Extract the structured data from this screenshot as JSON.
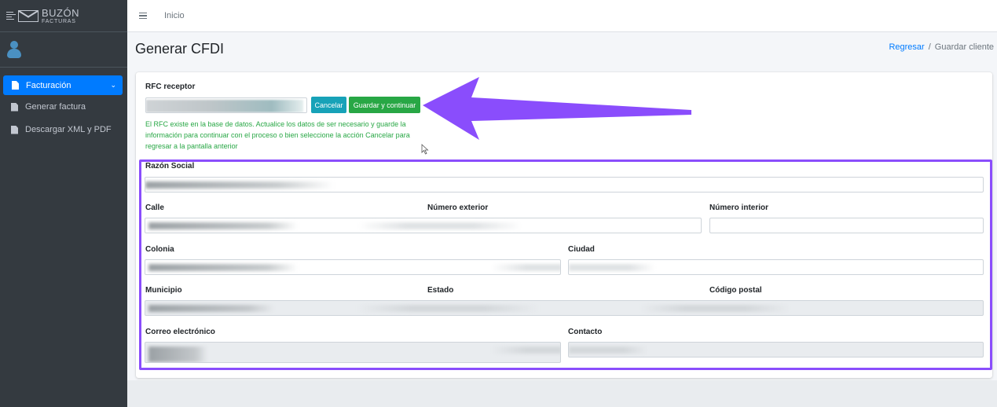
{
  "brand": {
    "name_top": "BUZÓN",
    "name_bottom": "FACTURAS"
  },
  "sidebar": {
    "items": [
      {
        "label": "Facturación",
        "active": true
      },
      {
        "label": "Generar factura",
        "active": false
      },
      {
        "label": "Descargar XML y PDF",
        "active": false
      }
    ]
  },
  "header": {
    "home_label": "Inicio"
  },
  "page": {
    "title": "Generar CFDI",
    "breadcrumb": {
      "back_link": "Regresar",
      "separator": "/",
      "current": "Guardar cliente"
    }
  },
  "form": {
    "rfc_label": "RFC receptor",
    "cancel_label": "Cancelar",
    "save_label": "Guardar y continuar",
    "help_text": "El RFC existe en la base de datos. Actualice los datos de ser necesario y guarde la información para continuar con el proceso o bien seleccione la acción Cancelar para regresar a la pantalla anterior",
    "fields": {
      "razon_social": "Razón Social",
      "calle": "Calle",
      "numero_exterior": "Número exterior",
      "numero_interior": "Número interior",
      "colonia": "Colonia",
      "ciudad": "Ciudad",
      "municipio": "Municipio",
      "estado": "Estado",
      "codigo_postal": "Código postal",
      "correo": "Correo electrónico",
      "contacto": "Contacto"
    }
  },
  "colors": {
    "sidebar_bg": "#343a40",
    "active_item": "#007bff",
    "cancel_button": "#17a2b8",
    "save_button": "#28a745",
    "help_text": "#28a745",
    "annotation": "#8a4dfc"
  }
}
